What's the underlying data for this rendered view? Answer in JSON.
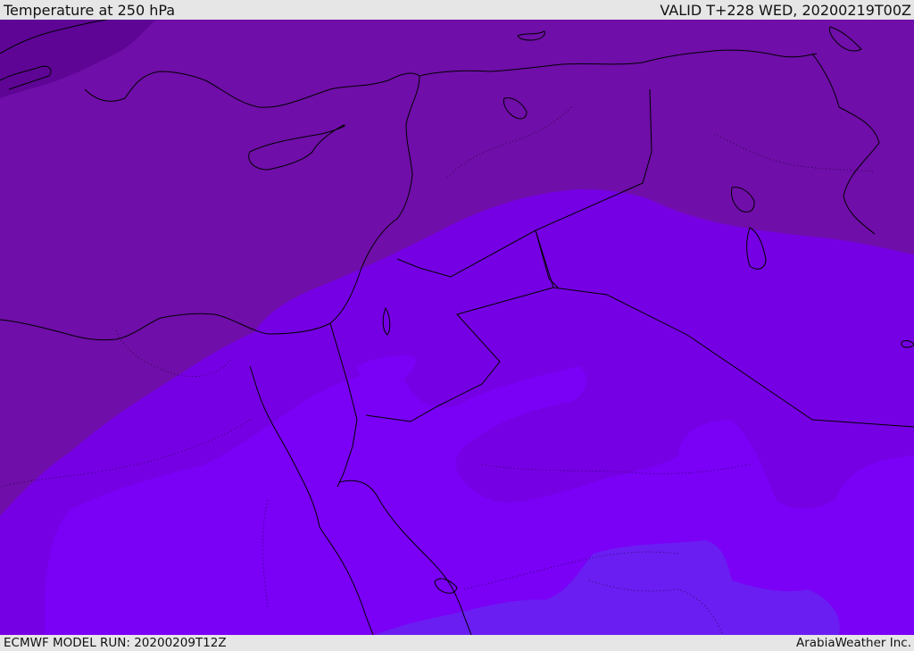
{
  "header": {
    "title": "Temperature at 250 hPa",
    "valid": "VALID T+228 WED, 20200219T00Z"
  },
  "footer": {
    "model_run": "ECMWF MODEL RUN: 20200209T12Z",
    "brand": "ArabiaWeather Inc."
  },
  "map": {
    "variable": "temperature",
    "level": "250 hPa",
    "colors": {
      "coldest": "#5e0596",
      "band_1": "#6f0ea8",
      "band_2": "#7508c6",
      "band_3": "#7600e4",
      "band_4": "#7a00f6",
      "band_5": "#6a1ef2",
      "coastline": "#000000"
    }
  }
}
